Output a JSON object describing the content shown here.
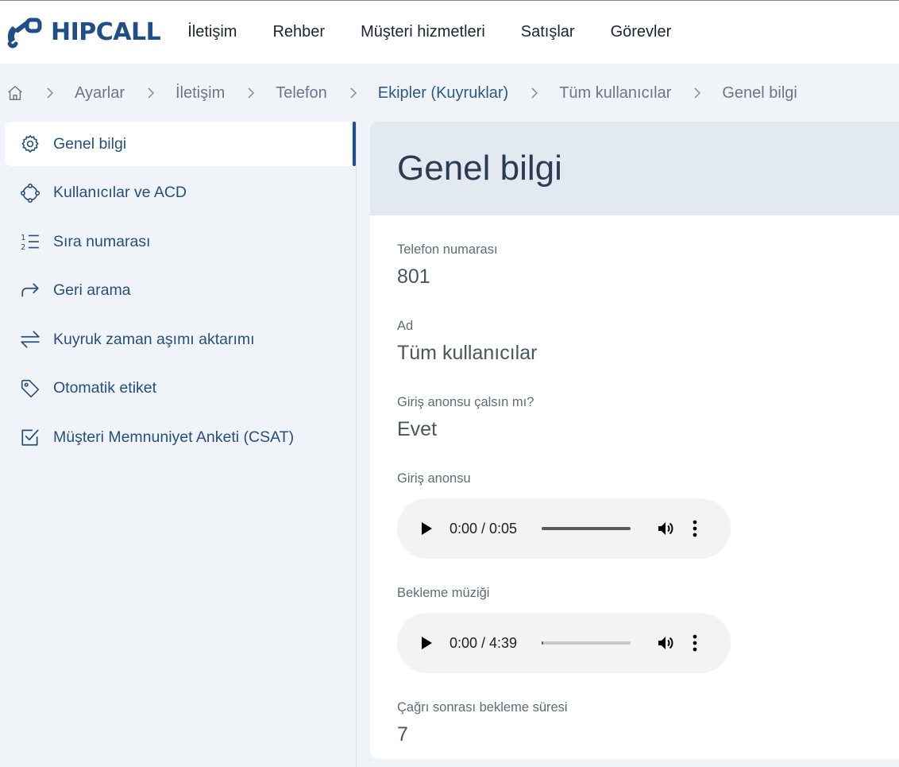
{
  "brand": {
    "name": "HIPCALL",
    "color": "#1f4f86"
  },
  "topnav": [
    {
      "label": "İletişim"
    },
    {
      "label": "Rehber"
    },
    {
      "label": "Müşteri hizmetleri"
    },
    {
      "label": "Satışlar"
    },
    {
      "label": "Görevler"
    }
  ],
  "breadcrumb": {
    "home_icon": "home-icon",
    "items": [
      "Ayarlar",
      "İletişim",
      "Telefon",
      "Ekipler (Kuyruklar)",
      "Tüm kullanıcılar",
      "Genel bilgi"
    ]
  },
  "sidebar": {
    "items": [
      {
        "label": "Genel bilgi",
        "icon": "gear-icon",
        "active": true
      },
      {
        "label": "Kullanıcılar ve ACD",
        "icon": "users-circle-icon"
      },
      {
        "label": "Sıra numarası",
        "icon": "numbered-list-icon"
      },
      {
        "label": "Geri arama",
        "icon": "redirect-arrow-icon"
      },
      {
        "label": "Kuyruk zaman aşımı aktarımı",
        "icon": "transfer-arrows-icon"
      },
      {
        "label": "Otomatik etiket",
        "icon": "tag-icon"
      },
      {
        "label": "Müşteri Memnuniyet Anketi (CSAT)",
        "icon": "checkbox-icon"
      }
    ]
  },
  "main": {
    "title": "Genel bilgi",
    "fields": {
      "phone": {
        "label": "Telefon numarası",
        "value": "801"
      },
      "name": {
        "label": "Ad",
        "value": "Tüm kullanıcılar"
      },
      "intro_play": {
        "label": "Giriş anonsu çalsın mı?",
        "value": "Evet"
      },
      "intro_audio": {
        "label": "Giriş anonsu",
        "time": "0:00 / 0:05",
        "buffered_fraction": 1.0
      },
      "hold_music": {
        "label": "Bekleme müziği",
        "time": "0:00 / 4:39",
        "buffered_fraction": 0.02
      },
      "after_call": {
        "label": "Çağrı sonrası bekleme süresi",
        "value": "7"
      }
    }
  }
}
